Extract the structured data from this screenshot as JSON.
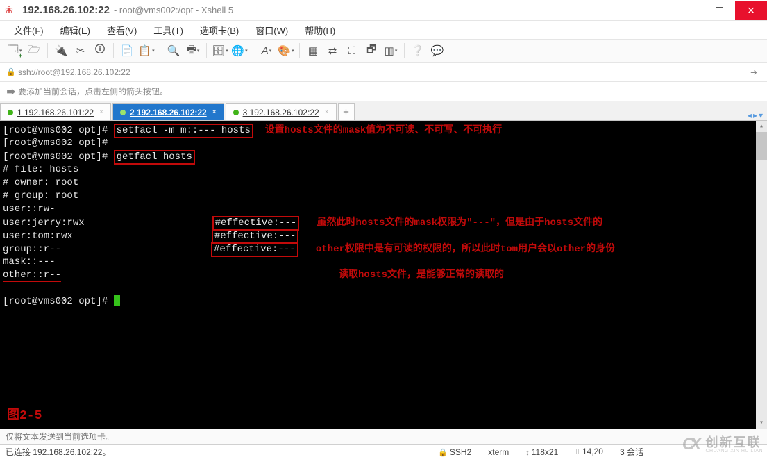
{
  "window": {
    "title_ip": "192.168.26.102:22",
    "title_path": "root@vms002:/opt - Xshell 5"
  },
  "menu": [
    "文件(F)",
    "编辑(E)",
    "查看(V)",
    "工具(T)",
    "选项卡(B)",
    "窗口(W)",
    "帮助(H)"
  ],
  "address": "ssh://root@192.168.26.102:22",
  "hint": "要添加当前会话，点击左侧的箭头按钮。",
  "tabs": [
    {
      "label": "1 192.168.26.101:22",
      "active": false
    },
    {
      "label": "2 192.168.26.102:22",
      "active": true
    },
    {
      "label": "3 192.168.26.102:22",
      "active": false
    }
  ],
  "terminal": {
    "prompt": "[root@vms002 opt]# ",
    "cmd1": "setfacl -m m::--- hosts",
    "note1": "设置hosts文件的mask值为不可读、不可写、不可执行",
    "cmd2": "getfacl hosts",
    "output": [
      "# file: hosts",
      "# owner: root",
      "# group: root",
      "user::rw-",
      "user:jerry:rwx",
      "user:tom:rwx",
      "group::r--",
      "mask::---",
      "other::r--"
    ],
    "eff_box": [
      "#effective:---",
      "#effective:---",
      "#effective:---"
    ],
    "note2_l1": "虽然此时hosts文件的mask权限为\"---\"，但是由于hosts文件的",
    "note2_l2": "other权限中是有可读的权限的，所以此时tom用户会以other的身份",
    "note2_l3": "读取hosts文件，是能够正常的读取的",
    "figure": "图2-5"
  },
  "footer1": "仅将文本发送到当前选项卡。",
  "footer2": {
    "conn": "已连接 192.168.26.102:22。",
    "ssh": "SSH2",
    "term": "xterm",
    "size": "118x21",
    "pos": "14,20",
    "sess": "3 会话"
  },
  "watermark": {
    "cn": "创新互联",
    "en": "CHUANG XIN HU LIAN"
  }
}
